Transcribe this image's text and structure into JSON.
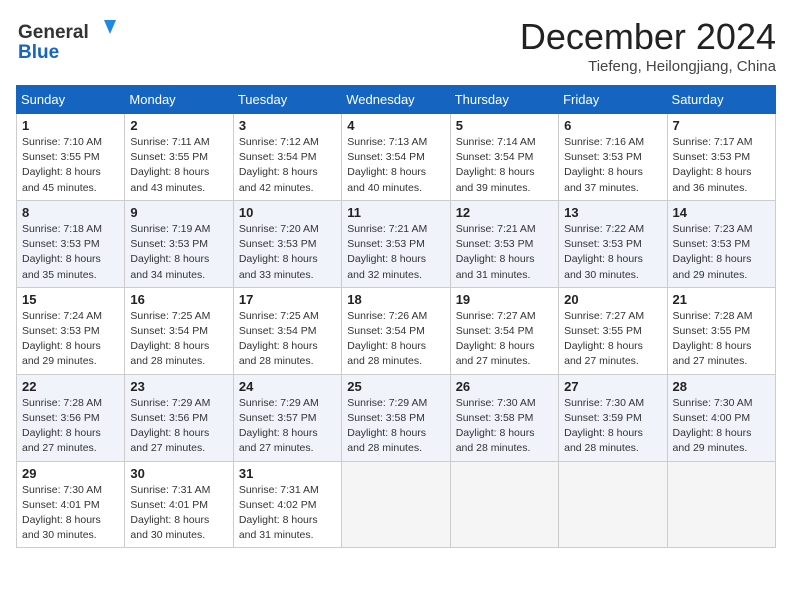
{
  "header": {
    "logo_line1": "General",
    "logo_line2": "Blue",
    "month_title": "December 2024",
    "location": "Tiefeng, Heilongjiang, China"
  },
  "weekdays": [
    "Sunday",
    "Monday",
    "Tuesday",
    "Wednesday",
    "Thursday",
    "Friday",
    "Saturday"
  ],
  "weeks": [
    [
      {
        "day": "1",
        "info": "Sunrise: 7:10 AM\nSunset: 3:55 PM\nDaylight: 8 hours\nand 45 minutes."
      },
      {
        "day": "2",
        "info": "Sunrise: 7:11 AM\nSunset: 3:55 PM\nDaylight: 8 hours\nand 43 minutes."
      },
      {
        "day": "3",
        "info": "Sunrise: 7:12 AM\nSunset: 3:54 PM\nDaylight: 8 hours\nand 42 minutes."
      },
      {
        "day": "4",
        "info": "Sunrise: 7:13 AM\nSunset: 3:54 PM\nDaylight: 8 hours\nand 40 minutes."
      },
      {
        "day": "5",
        "info": "Sunrise: 7:14 AM\nSunset: 3:54 PM\nDaylight: 8 hours\nand 39 minutes."
      },
      {
        "day": "6",
        "info": "Sunrise: 7:16 AM\nSunset: 3:53 PM\nDaylight: 8 hours\nand 37 minutes."
      },
      {
        "day": "7",
        "info": "Sunrise: 7:17 AM\nSunset: 3:53 PM\nDaylight: 8 hours\nand 36 minutes."
      }
    ],
    [
      {
        "day": "8",
        "info": "Sunrise: 7:18 AM\nSunset: 3:53 PM\nDaylight: 8 hours\nand 35 minutes."
      },
      {
        "day": "9",
        "info": "Sunrise: 7:19 AM\nSunset: 3:53 PM\nDaylight: 8 hours\nand 34 minutes."
      },
      {
        "day": "10",
        "info": "Sunrise: 7:20 AM\nSunset: 3:53 PM\nDaylight: 8 hours\nand 33 minutes."
      },
      {
        "day": "11",
        "info": "Sunrise: 7:21 AM\nSunset: 3:53 PM\nDaylight: 8 hours\nand 32 minutes."
      },
      {
        "day": "12",
        "info": "Sunrise: 7:21 AM\nSunset: 3:53 PM\nDaylight: 8 hours\nand 31 minutes."
      },
      {
        "day": "13",
        "info": "Sunrise: 7:22 AM\nSunset: 3:53 PM\nDaylight: 8 hours\nand 30 minutes."
      },
      {
        "day": "14",
        "info": "Sunrise: 7:23 AM\nSunset: 3:53 PM\nDaylight: 8 hours\nand 29 minutes."
      }
    ],
    [
      {
        "day": "15",
        "info": "Sunrise: 7:24 AM\nSunset: 3:53 PM\nDaylight: 8 hours\nand 29 minutes."
      },
      {
        "day": "16",
        "info": "Sunrise: 7:25 AM\nSunset: 3:54 PM\nDaylight: 8 hours\nand 28 minutes."
      },
      {
        "day": "17",
        "info": "Sunrise: 7:25 AM\nSunset: 3:54 PM\nDaylight: 8 hours\nand 28 minutes."
      },
      {
        "day": "18",
        "info": "Sunrise: 7:26 AM\nSunset: 3:54 PM\nDaylight: 8 hours\nand 28 minutes."
      },
      {
        "day": "19",
        "info": "Sunrise: 7:27 AM\nSunset: 3:54 PM\nDaylight: 8 hours\nand 27 minutes."
      },
      {
        "day": "20",
        "info": "Sunrise: 7:27 AM\nSunset: 3:55 PM\nDaylight: 8 hours\nand 27 minutes."
      },
      {
        "day": "21",
        "info": "Sunrise: 7:28 AM\nSunset: 3:55 PM\nDaylight: 8 hours\nand 27 minutes."
      }
    ],
    [
      {
        "day": "22",
        "info": "Sunrise: 7:28 AM\nSunset: 3:56 PM\nDaylight: 8 hours\nand 27 minutes."
      },
      {
        "day": "23",
        "info": "Sunrise: 7:29 AM\nSunset: 3:56 PM\nDaylight: 8 hours\nand 27 minutes."
      },
      {
        "day": "24",
        "info": "Sunrise: 7:29 AM\nSunset: 3:57 PM\nDaylight: 8 hours\nand 27 minutes."
      },
      {
        "day": "25",
        "info": "Sunrise: 7:29 AM\nSunset: 3:58 PM\nDaylight: 8 hours\nand 28 minutes."
      },
      {
        "day": "26",
        "info": "Sunrise: 7:30 AM\nSunset: 3:58 PM\nDaylight: 8 hours\nand 28 minutes."
      },
      {
        "day": "27",
        "info": "Sunrise: 7:30 AM\nSunset: 3:59 PM\nDaylight: 8 hours\nand 28 minutes."
      },
      {
        "day": "28",
        "info": "Sunrise: 7:30 AM\nSunset: 4:00 PM\nDaylight: 8 hours\nand 29 minutes."
      }
    ],
    [
      {
        "day": "29",
        "info": "Sunrise: 7:30 AM\nSunset: 4:01 PM\nDaylight: 8 hours\nand 30 minutes."
      },
      {
        "day": "30",
        "info": "Sunrise: 7:31 AM\nSunset: 4:01 PM\nDaylight: 8 hours\nand 30 minutes."
      },
      {
        "day": "31",
        "info": "Sunrise: 7:31 AM\nSunset: 4:02 PM\nDaylight: 8 hours\nand 31 minutes."
      },
      {
        "day": "",
        "info": ""
      },
      {
        "day": "",
        "info": ""
      },
      {
        "day": "",
        "info": ""
      },
      {
        "day": "",
        "info": ""
      }
    ]
  ]
}
